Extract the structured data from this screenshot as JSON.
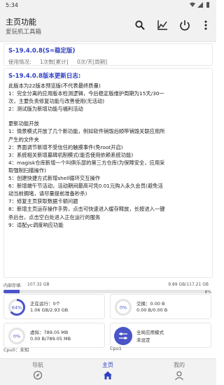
{
  "status_bar": {
    "time": "5:34"
  },
  "app_bar": {
    "title": "主页功能",
    "subtitle": "爱玩机工具箱",
    "icons": [
      "search-icon",
      "chart-icon",
      "power-icon",
      "more-vert-icon"
    ]
  },
  "version_card": {
    "title": "S-19.4.0.8(S=稳定版)",
    "usage_label": "使用情况:",
    "usage_count": "1次数[累计]",
    "usage_rate": "0次/天[周期]"
  },
  "log": {
    "title": "S-19.4.0.8版本更新日志:",
    "lines": [
      "此版本为22版本预览版(不代表最终质量)",
      "1：完全分离的应用版本检测逻辑，今后稳定版维护周期为15天/30一",
      "次，主要负责修复功能与改善使用(无活动)",
      "2：测试版为新增功能与福利活动",
      "",
      "更新功能开放",
      "1：情景模式开放了几个新功能，例如软件销毁后顺带销毁关联应用所",
      "产生的文件夹",
      "2：界面调节新增不受信任的触摸事件(免root开启)",
      "3：系统相关新增墓碑机制模式(能否使用依赖系统功能)",
      "4：magisk仓库新增一个叫俱乐部的第三方仓库(为保障安全，应用采",
      "取强制扫描操作)",
      "5：创建快捷方式新增shell循环交互操作",
      "6：新增端午节活动，活动期间最高可凭0.01元购入永久会员(避免活",
      "动当前拥堵，请尽量提前准备秒杀)",
      "7：修复主页获取数据卡顿问题",
      "8：新增主页运存操作手势，点击可快速进入缓存释放，长按进入一键",
      "杀后台，点击空白处进入正在运行的服务",
      "9：适配yc调度响应功能"
    ]
  },
  "storage": {
    "label": "内部存储:",
    "used": "107.32 GB",
    "total": "9.89 GB/117.21 GB",
    "percent_text": "8%",
    "percent": 0.08
  },
  "tiles": [
    {
      "ring_text": "64%",
      "line1": "正在运行：0个",
      "line2": "1.06 GB/2.93 GB",
      "value": 0.64,
      "color": "#4a55c8",
      "icon": "ring-gauge"
    },
    {
      "ring_text": "0%",
      "line1": "交换：0.00 B",
      "line2": "0.00 B/0.00 B",
      "value": 0,
      "color": "#4a55c8",
      "icon": "ring-gauge"
    },
    {
      "ring_text": "0%",
      "line1": "虚拟：789.05 MB",
      "line2": "0.00 B/789.05 MB",
      "value": 0,
      "color": "#4a55c8",
      "icon": "ring-gauge"
    },
    {
      "ring_text": "",
      "line1": "全局应用模式",
      "line2": "未设定",
      "value": 1,
      "color": "#4a55c8",
      "icon": "sliders-icon"
    }
  ],
  "cpu": {
    "cpu0": "Cpu0：未知",
    "cpu1": "Cpu1"
  },
  "bottom_nav": {
    "items": [
      {
        "label": "导航",
        "icon": "compass-icon"
      },
      {
        "label": "主页",
        "icon": "home-icon"
      },
      {
        "label": "我的",
        "icon": "person-icon"
      }
    ],
    "active_index": 1
  }
}
